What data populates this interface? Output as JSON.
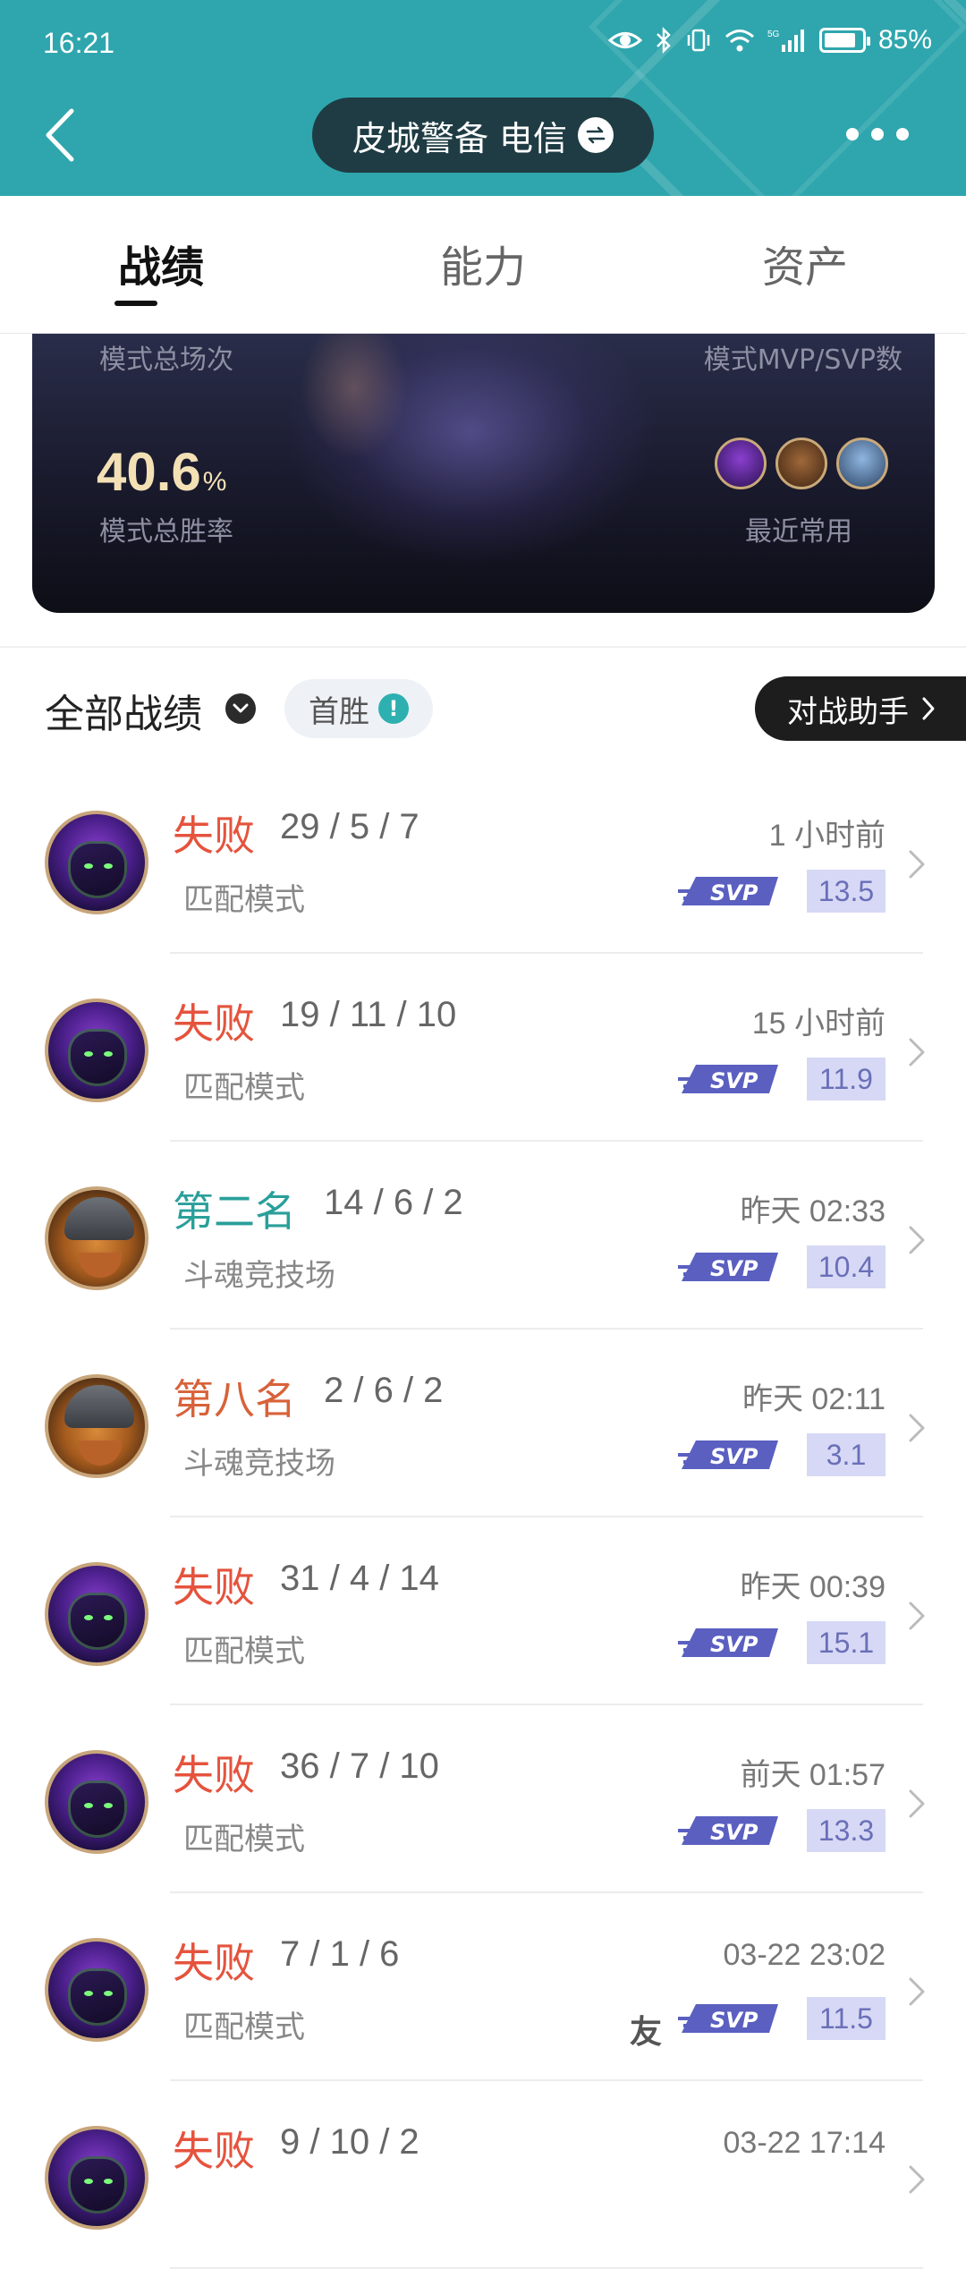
{
  "status_bar": {
    "time": "16:21",
    "battery": "85%",
    "battery_fraction": 0.85,
    "network": "5G",
    "icons": [
      "eye-icon",
      "bluetooth-icon",
      "vibrate-icon",
      "wifi-icon",
      "signal-icon",
      "battery-icon"
    ]
  },
  "header": {
    "account": "皮城警备 电信",
    "bg_color": "#2fa6ad"
  },
  "tabs": [
    {
      "label": "战绩",
      "active": true
    },
    {
      "label": "能力",
      "active": false
    },
    {
      "label": "资产",
      "active": false
    }
  ],
  "summary": {
    "total_games_label": "模式总场次",
    "mvp_label": "模式MVP/SVP数",
    "winrate_value": "40.6",
    "winrate_unit": "%",
    "winrate_label": "模式总胜率",
    "recent_label": "最近常用",
    "recent_heroes": [
      "purple-hero-avatar",
      "warrior-hero-avatar",
      "knight-hero-avatar"
    ]
  },
  "filters": {
    "title": "全部战绩",
    "first_win": "首胜",
    "assistant": "对战助手"
  },
  "matches": [
    {
      "result": "失败",
      "result_type": "lose",
      "kda": "29 / 5 / 7",
      "mode": "匹配模式",
      "time": "1 小时前",
      "badge": "SVP",
      "score": "13.5",
      "hero": "purple",
      "friend": ""
    },
    {
      "result": "失败",
      "result_type": "lose",
      "kda": "19 / 11 / 10",
      "mode": "匹配模式",
      "time": "15 小时前",
      "badge": "SVP",
      "score": "11.9",
      "hero": "purple",
      "friend": ""
    },
    {
      "result": "第二名",
      "result_type": "second",
      "kda": "14 / 6 / 2",
      "mode": "斗魂竞技场",
      "time": "昨天 02:33",
      "badge": "SVP",
      "score": "10.4",
      "hero": "viking",
      "friend": ""
    },
    {
      "result": "第八名",
      "result_type": "eighth",
      "kda": "2 / 6 / 2",
      "mode": "斗魂竞技场",
      "time": "昨天 02:11",
      "badge": "SVP",
      "score": "3.1",
      "hero": "viking",
      "friend": ""
    },
    {
      "result": "失败",
      "result_type": "lose",
      "kda": "31 / 4 / 14",
      "mode": "匹配模式",
      "time": "昨天 00:39",
      "badge": "SVP",
      "score": "15.1",
      "hero": "purple",
      "friend": ""
    },
    {
      "result": "失败",
      "result_type": "lose",
      "kda": "36 / 7 / 10",
      "mode": "匹配模式",
      "time": "前天 01:57",
      "badge": "SVP",
      "score": "13.3",
      "hero": "purple",
      "friend": ""
    },
    {
      "result": "失败",
      "result_type": "lose",
      "kda": "7 / 1 / 6",
      "mode": "匹配模式",
      "time": "03-22 23:02",
      "badge": "SVP",
      "score": "11.5",
      "hero": "purple",
      "friend": "友"
    },
    {
      "result": "失败",
      "result_type": "lose",
      "kda": "9 / 10 / 2",
      "mode": "",
      "time": "03-22 17:14",
      "badge": "",
      "score": "",
      "hero": "purple",
      "friend": ""
    }
  ]
}
